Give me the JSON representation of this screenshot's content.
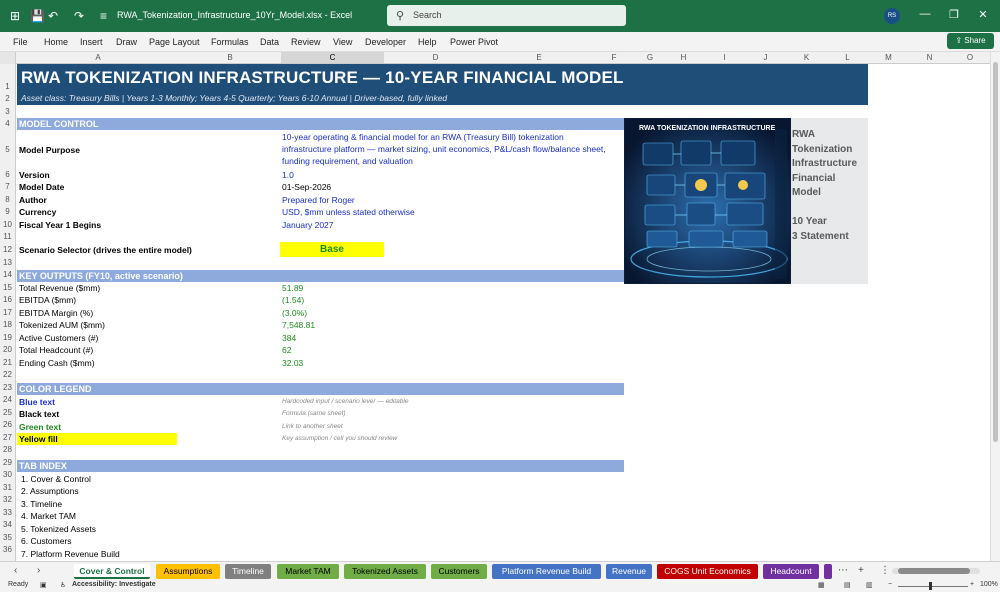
{
  "titlebar": {
    "filename": "RWA_Tokenization_Infrastructure_10Yr_Model.xlsx",
    "app": "Excel",
    "search_placeholder": "Search",
    "avatar_initials": "RS"
  },
  "menu": [
    "File",
    "Home",
    "Insert",
    "Draw",
    "Page Layout",
    "Formulas",
    "Data",
    "Review",
    "View",
    "Developer",
    "Help",
    "Power Pivot"
  ],
  "share_label": "Share",
  "columns": [
    "A",
    "B",
    "C",
    "D",
    "E",
    "F",
    "G",
    "H",
    "I",
    "J",
    "K",
    "L",
    "M",
    "N",
    "O"
  ],
  "selected_column": "C",
  "rows": [
    "1",
    "2",
    "3",
    "4",
    "5",
    "6",
    "7",
    "8",
    "9",
    "10",
    "11",
    "12",
    "13",
    "14",
    "15",
    "16",
    "17",
    "18",
    "19",
    "20",
    "21",
    "22",
    "23",
    "24",
    "25",
    "26",
    "27",
    "28",
    "29",
    "30",
    "31",
    "32",
    "33",
    "34",
    "35",
    "36"
  ],
  "sheet": {
    "title": "RWA TOKENIZATION INFRASTRUCTURE — 10-YEAR FINANCIAL MODEL",
    "subtitle": "Asset class: Treasury Bills  |  Years 1-3 Monthly; Years 4-5 Quarterly; Years 6-10 Annual  |  Driver-based, fully linked",
    "model_control": "MODEL CONTROL",
    "purpose_label": "Model Purpose",
    "purpose_lines": [
      "10-year operating & financial model for an RWA (Treasury Bill) tokenization",
      "infrastructure platform — market sizing, unit economics, P&L/cash flow/balance sheet,",
      "funding requirement, and valuation"
    ],
    "version_label": "Version",
    "version_value": "1.0",
    "date_label": "Model Date",
    "date_value": "01-Sep-2026",
    "author_label": "Author",
    "author_value": "Prepared for Roger",
    "currency_label": "Currency",
    "currency_value": "USD, $mm unless stated otherwise",
    "fy_label": "Fiscal Year 1 Begins",
    "fy_value": "January 2027",
    "scenario_label": "Scenario Selector (drives the entire model)",
    "scenario_value": "Base",
    "key_outputs": "KEY OUTPUTS (FY10, active scenario)",
    "outputs": [
      {
        "label": "Total Revenue ($mm)",
        "value": "51.89"
      },
      {
        "label": "EBITDA ($mm)",
        "value": "(1.54)"
      },
      {
        "label": "EBITDA Margin (%)",
        "value": "(3.0%)"
      },
      {
        "label": "Tokenized AUM ($mm)",
        "value": "7,548.81"
      },
      {
        "label": "Active Customers (#)",
        "value": "384"
      },
      {
        "label": "Total Headcount (#)",
        "value": "62"
      },
      {
        "label": "Ending Cash ($mm)",
        "value": "32.03"
      }
    ],
    "color_legend": "COLOR LEGEND",
    "legend": [
      {
        "label": "Blue text",
        "desc": "Hardcoded input / scenario lever — editable"
      },
      {
        "label": "Black text",
        "desc": "Formula (same sheet)"
      },
      {
        "label": "Green text",
        "desc": "Link to another sheet"
      },
      {
        "label": "Yellow fill",
        "desc": "Key assumption / cell you should review"
      }
    ],
    "tab_index": "TAB INDEX",
    "tab_list": [
      "1. Cover & Control",
      "2. Assumptions",
      "3. Timeline",
      "4. Market TAM",
      "5. Tokenized Assets",
      "6. Customers",
      "7. Platform Revenue Build"
    ],
    "image_title": "RWA TOKENIZATION INFRASTRUCTURE",
    "image_side_lines": [
      "RWA",
      "Tokenization",
      "Infrastructure",
      "Financial",
      "Model",
      "",
      "10 Year",
      "3 Statement"
    ]
  },
  "tabs": [
    {
      "label": "Cover & Control",
      "color": "#ffffff"
    },
    {
      "label": "Assumptions",
      "color": "#ffc000"
    },
    {
      "label": "Timeline",
      "color": "#808080"
    },
    {
      "label": "Market TAM",
      "color": "#70ad47"
    },
    {
      "label": "Tokenized Assets",
      "color": "#70ad47"
    },
    {
      "label": "Customers",
      "color": "#70ad47"
    },
    {
      "label": "Platform Revenue Build",
      "color": "#4472c4"
    },
    {
      "label": "Revenue",
      "color": "#4472c4"
    },
    {
      "label": "COGS Unit Economics",
      "color": "#c00000"
    },
    {
      "label": "Headcount",
      "color": "#7030a0"
    }
  ],
  "status": {
    "ready": "Ready",
    "accessibility": "Accessibility: Investigate",
    "zoom": "100%"
  }
}
